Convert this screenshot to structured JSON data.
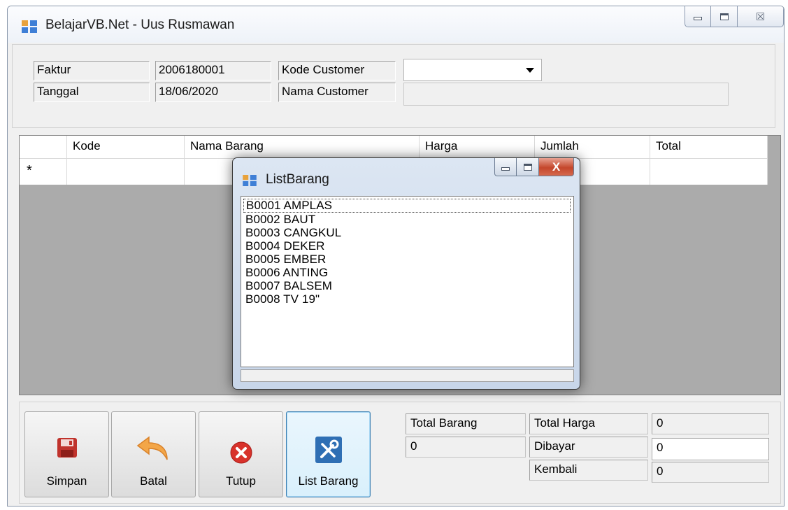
{
  "window": {
    "title": "BelajarVB.Net - Uus Rusmawan",
    "close_glyph": "☒"
  },
  "form": {
    "faktur_label": "Faktur",
    "faktur_value": "2006180001",
    "tanggal_label": "Tanggal",
    "tanggal_value": "18/06/2020",
    "kode_customer_label": "Kode Customer",
    "kode_customer_value": "",
    "nama_customer_label": "Nama Customer",
    "nama_customer_value": ""
  },
  "grid": {
    "columns": [
      "Kode",
      "Nama Barang",
      "Harga",
      "Jumlah",
      "Total"
    ],
    "new_row_marker": "*"
  },
  "buttons": {
    "simpan": "Simpan",
    "batal": "Batal",
    "tutup": "Tutup",
    "list_barang": "List Barang"
  },
  "summary": {
    "total_barang_label": "Total Barang",
    "total_barang_value": "0",
    "total_harga_label": "Total Harga",
    "total_harga_value": "0",
    "dibayar_label": "Dibayar",
    "dibayar_value": "0",
    "kembali_label": "Kembali",
    "kembali_value": "0"
  },
  "dialog": {
    "title": "ListBarang",
    "close_glyph": "X",
    "items": [
      "B0001  AMPLAS",
      "B0002  BAUT",
      "B0003  CANGKUL",
      "B0004  DEKER",
      "B0005  EMBER",
      "B0006  ANTING",
      "B0007  BALSEM",
      "B0008  TV 19\""
    ]
  },
  "colors": {
    "grid_background": "#ababab",
    "active_button_border": "#3c7fb1",
    "dialog_close": "#c4472c"
  }
}
